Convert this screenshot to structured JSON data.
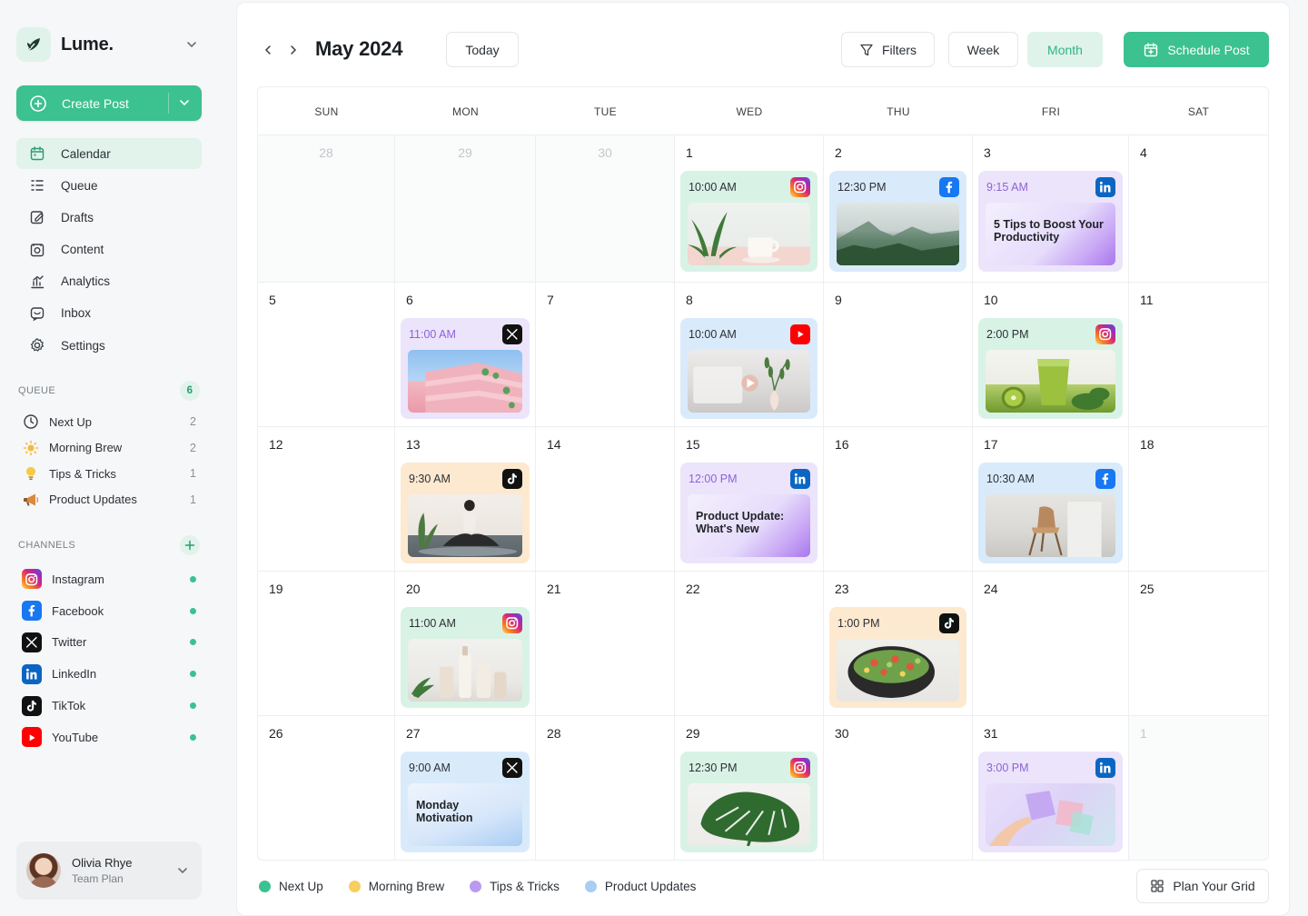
{
  "brand": {
    "name": "Lume."
  },
  "sidebar": {
    "create_label": "Create Post",
    "nav": [
      {
        "label": "Calendar",
        "icon": "calendar-icon",
        "active": true
      },
      {
        "label": "Queue",
        "icon": "queue-icon",
        "active": false
      },
      {
        "label": "Drafts",
        "icon": "drafts-icon",
        "active": false
      },
      {
        "label": "Content",
        "icon": "content-icon",
        "active": false
      },
      {
        "label": "Analytics",
        "icon": "analytics-icon",
        "active": false
      },
      {
        "label": "Inbox",
        "icon": "inbox-icon",
        "active": false
      },
      {
        "label": "Settings",
        "icon": "settings-icon",
        "active": false
      }
    ],
    "queue_heading": "QUEUE",
    "queue_count": "6",
    "queues": [
      {
        "label": "Next Up",
        "count": "2",
        "icon": "clock-icon"
      },
      {
        "label": "Morning Brew",
        "count": "2",
        "icon": "sun-icon"
      },
      {
        "label": "Tips & Tricks",
        "count": "1",
        "icon": "lightbulb-icon"
      },
      {
        "label": "Product Updates",
        "count": "1",
        "icon": "megaphone-icon"
      }
    ],
    "channels_heading": "CHANNELS",
    "channels": [
      {
        "label": "Instagram",
        "icon": "instagram-icon",
        "status": "connected"
      },
      {
        "label": "Facebook",
        "icon": "facebook-icon",
        "status": "connected"
      },
      {
        "label": "Twitter",
        "icon": "x-icon",
        "status": "connected"
      },
      {
        "label": "LinkedIn",
        "icon": "linkedin-icon",
        "status": "connected"
      },
      {
        "label": "TikTok",
        "icon": "tiktok-icon",
        "status": "connected"
      },
      {
        "label": "YouTube",
        "icon": "youtube-icon",
        "status": "connected"
      }
    ],
    "user": {
      "name": "Olivia Rhye",
      "plan": "Team Plan"
    }
  },
  "toolbar": {
    "title": "May 2024",
    "today_label": "Today",
    "filters_label": "Filters",
    "week_label": "Week",
    "month_label": "Month",
    "schedule_label": "Schedule Post"
  },
  "calendar": {
    "weekdays": [
      "SUN",
      "MON",
      "TUE",
      "WED",
      "THU",
      "FRI",
      "SAT"
    ],
    "weeks": [
      [
        {
          "day": "28",
          "out": true
        },
        {
          "day": "29",
          "out": true
        },
        {
          "day": "30",
          "out": true
        },
        {
          "day": "1",
          "post": {
            "time": "10:00 AM",
            "channel": "instagram",
            "queue": "next-up",
            "image": "plant-and-cup"
          }
        },
        {
          "day": "2",
          "post": {
            "time": "12:30 PM",
            "channel": "facebook",
            "queue": "product-updates",
            "image": "misty-mountains"
          }
        },
        {
          "day": "3",
          "post": {
            "time": "9:15 AM",
            "channel": "linkedin",
            "queue": "tips-tricks",
            "text": "5 Tips to Boost Your Productivity"
          }
        },
        {
          "day": "4"
        }
      ],
      [
        {
          "day": "5"
        },
        {
          "day": "6",
          "post": {
            "time": "11:00 AM",
            "channel": "twitter",
            "queue": "tips-tricks",
            "image": "pink-building"
          }
        },
        {
          "day": "7"
        },
        {
          "day": "8",
          "post": {
            "time": "10:00 AM",
            "channel": "youtube",
            "queue": "product-updates",
            "image": "video-vase"
          }
        },
        {
          "day": "9"
        },
        {
          "day": "10",
          "post": {
            "time": "2:00 PM",
            "channel": "instagram",
            "queue": "next-up",
            "image": "green-smoothie"
          }
        },
        {
          "day": "11"
        }
      ],
      [
        {
          "day": "12"
        },
        {
          "day": "13",
          "post": {
            "time": "9:30 AM",
            "channel": "tiktok",
            "queue": "morning-brew",
            "image": "yoga"
          }
        },
        {
          "day": "14"
        },
        {
          "day": "15",
          "post": {
            "time": "12:00 PM",
            "channel": "linkedin",
            "queue": "tips-tricks",
            "text": "Product Update: What's New"
          }
        },
        {
          "day": "16"
        },
        {
          "day": "17",
          "post": {
            "time": "10:30 AM",
            "channel": "facebook",
            "queue": "product-updates",
            "image": "chair"
          }
        },
        {
          "day": "18"
        }
      ],
      [
        {
          "day": "19"
        },
        {
          "day": "20",
          "post": {
            "time": "11:00 AM",
            "channel": "instagram",
            "queue": "next-up",
            "image": "bottles"
          }
        },
        {
          "day": "21"
        },
        {
          "day": "22"
        },
        {
          "day": "23",
          "post": {
            "time": "1:00 PM",
            "channel": "tiktok",
            "queue": "morning-brew",
            "image": "salad-bowl"
          }
        },
        {
          "day": "24"
        },
        {
          "day": "25"
        }
      ],
      [
        {
          "day": "26"
        },
        {
          "day": "27",
          "post": {
            "time": "9:00 AM",
            "channel": "twitter",
            "queue": "product-updates",
            "text": "Monday Motivation"
          }
        },
        {
          "day": "28"
        },
        {
          "day": "29",
          "post": {
            "time": "12:30 PM",
            "channel": "instagram",
            "queue": "next-up",
            "image": "monstera-leaf"
          }
        },
        {
          "day": "30"
        },
        {
          "day": "31",
          "post": {
            "time": "3:00 PM",
            "channel": "linkedin",
            "queue": "tips-tricks",
            "image": "cards-hand"
          }
        },
        {
          "day": "1",
          "out": true
        }
      ]
    ]
  },
  "legend": [
    {
      "label": "Next Up",
      "color": "#3cc191"
    },
    {
      "label": "Morning Brew",
      "color": "#f7cf5f"
    },
    {
      "label": "Tips & Tricks",
      "color": "#b99af0"
    },
    {
      "label": "Product Updates",
      "color": "#a9cdf3"
    }
  ],
  "plan_grid_label": "Plan Your Grid",
  "colors": {
    "accent": "#3cc191",
    "accent_soft": "#e1f3eb"
  }
}
